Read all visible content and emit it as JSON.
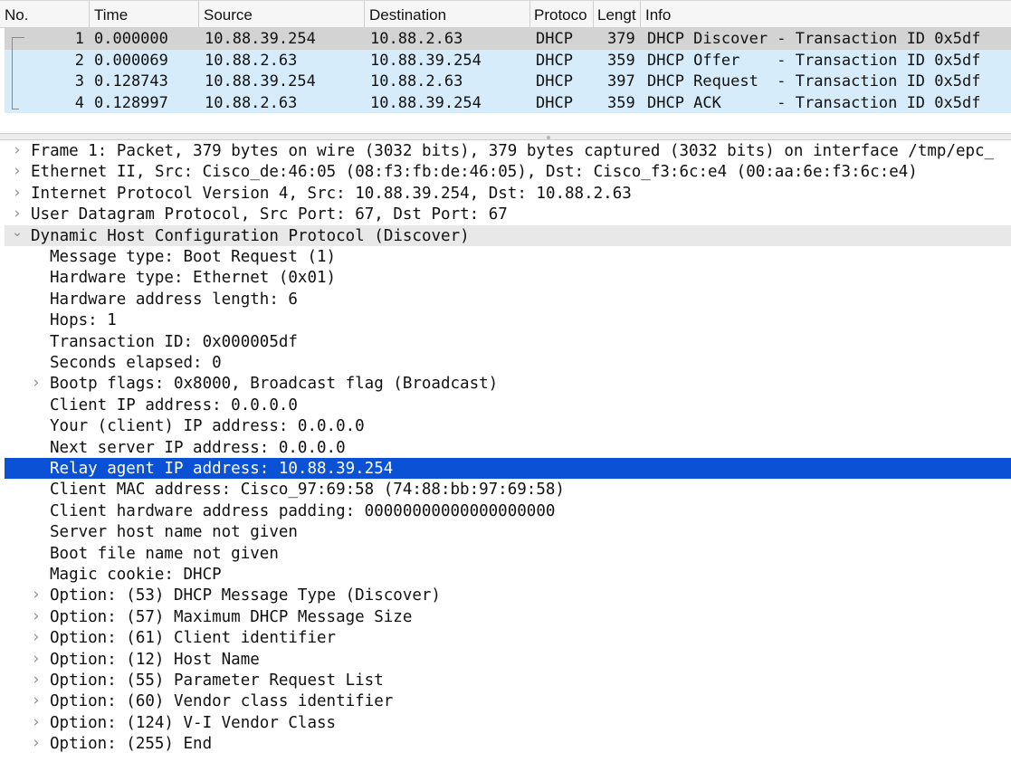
{
  "packet_list": {
    "columns": [
      "No.",
      "Time",
      "Source",
      "Destination",
      "Protoco",
      "Lengt",
      "Info"
    ],
    "rows": [
      {
        "no": "1",
        "time": "0.000000",
        "source": "10.88.39.254",
        "destination": "10.88.2.63",
        "protocol": "DHCP",
        "length": "379",
        "info": "DHCP Discover - Transaction ID 0x5df"
      },
      {
        "no": "2",
        "time": "0.000069",
        "source": "10.88.2.63",
        "destination": "10.88.39.254",
        "protocol": "DHCP",
        "length": "359",
        "info": "DHCP Offer    - Transaction ID 0x5df"
      },
      {
        "no": "3",
        "time": "0.128743",
        "source": "10.88.39.254",
        "destination": "10.88.2.63",
        "protocol": "DHCP",
        "length": "397",
        "info": "DHCP Request  - Transaction ID 0x5df"
      },
      {
        "no": "4",
        "time": "0.128997",
        "source": "10.88.2.63",
        "destination": "10.88.39.254",
        "protocol": "DHCP",
        "length": "359",
        "info": "DHCP ACK      - Transaction ID 0x5df"
      }
    ],
    "selected_row": "1"
  },
  "detail_tree": [
    {
      "text": "Frame 1: Packet, 379 bytes on wire (3032 bits), 379 bytes captured (3032 bits) on interface /tmp/epc_",
      "level": 0,
      "toggle": "collapsed"
    },
    {
      "text": "Ethernet II, Src: Cisco_de:46:05 (08:f3:fb:de:46:05), Dst: Cisco_f3:6c:e4 (00:aa:6e:f3:6c:e4)",
      "level": 0,
      "toggle": "collapsed"
    },
    {
      "text": "Internet Protocol Version 4, Src: 10.88.39.254, Dst: 10.88.2.63",
      "level": 0,
      "toggle": "collapsed"
    },
    {
      "text": "User Datagram Protocol, Src Port: 67, Dst Port: 67",
      "level": 0,
      "toggle": "collapsed"
    },
    {
      "text": "Dynamic Host Configuration Protocol (Discover)",
      "level": 0,
      "toggle": "expanded"
    },
    {
      "text": "Message type: Boot Request (1)",
      "level": 1,
      "toggle": "none"
    },
    {
      "text": "Hardware type: Ethernet (0x01)",
      "level": 1,
      "toggle": "none"
    },
    {
      "text": "Hardware address length: 6",
      "level": 1,
      "toggle": "none"
    },
    {
      "text": "Hops: 1",
      "level": 1,
      "toggle": "none"
    },
    {
      "text": "Transaction ID: 0x000005df",
      "level": 1,
      "toggle": "none"
    },
    {
      "text": "Seconds elapsed: 0",
      "level": 1,
      "toggle": "none"
    },
    {
      "text": "Bootp flags: 0x8000, Broadcast flag (Broadcast)",
      "level": 1,
      "toggle": "collapsed"
    },
    {
      "text": "Client IP address: 0.0.0.0",
      "level": 1,
      "toggle": "none"
    },
    {
      "text": "Your (client) IP address: 0.0.0.0",
      "level": 1,
      "toggle": "none"
    },
    {
      "text": "Next server IP address: 0.0.0.0",
      "level": 1,
      "toggle": "none"
    },
    {
      "text": "Relay agent IP address: 10.88.39.254",
      "level": 1,
      "toggle": "none",
      "selected": true
    },
    {
      "text": "Client MAC address: Cisco_97:69:58 (74:88:bb:97:69:58)",
      "level": 1,
      "toggle": "none"
    },
    {
      "text": "Client hardware address padding: 00000000000000000000",
      "level": 1,
      "toggle": "none"
    },
    {
      "text": "Server host name not given",
      "level": 1,
      "toggle": "none"
    },
    {
      "text": "Boot file name not given",
      "level": 1,
      "toggle": "none"
    },
    {
      "text": "Magic cookie: DHCP",
      "level": 1,
      "toggle": "none"
    },
    {
      "text": "Option: (53) DHCP Message Type (Discover)",
      "level": 1,
      "toggle": "collapsed"
    },
    {
      "text": "Option: (57) Maximum DHCP Message Size",
      "level": 1,
      "toggle": "collapsed"
    },
    {
      "text": "Option: (61) Client identifier",
      "level": 1,
      "toggle": "collapsed"
    },
    {
      "text": "Option: (12) Host Name",
      "level": 1,
      "toggle": "collapsed"
    },
    {
      "text": "Option: (55) Parameter Request List",
      "level": 1,
      "toggle": "collapsed"
    },
    {
      "text": "Option: (60) Vendor class identifier",
      "level": 1,
      "toggle": "collapsed"
    },
    {
      "text": "Option: (124) V-I Vendor Class",
      "level": 1,
      "toggle": "collapsed"
    },
    {
      "text": "Option: (255) End",
      "level": 1,
      "toggle": "collapsed"
    }
  ],
  "icons": {
    "collapsed": "chevron-right-icon",
    "expanded": "chevron-down-icon"
  },
  "colors": {
    "selection": "#0a51d5",
    "related_row": "#d7ecfb",
    "selected_packet": "#d3d3d3"
  }
}
